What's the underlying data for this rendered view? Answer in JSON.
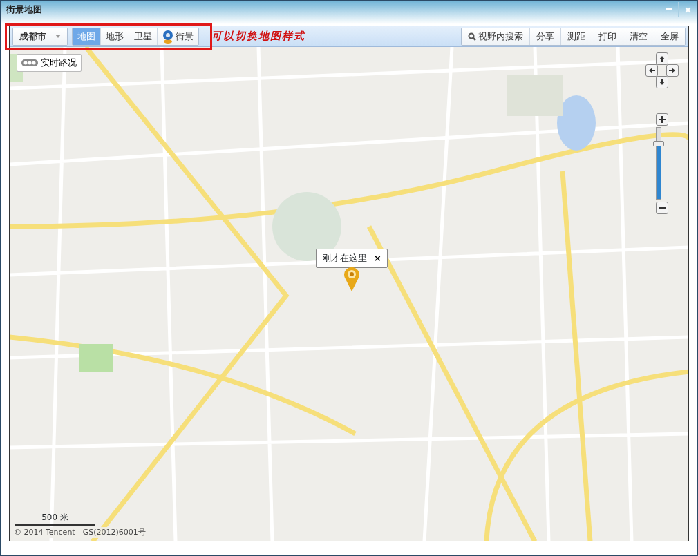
{
  "window": {
    "title": "街景地图"
  },
  "toolbar": {
    "city_select": {
      "value": "成都市"
    },
    "map_types": [
      {
        "label": "地图",
        "selected": true,
        "kind": "plain"
      },
      {
        "label": "地形",
        "selected": false,
        "kind": "plain"
      },
      {
        "label": "卫星",
        "selected": false,
        "kind": "plain"
      },
      {
        "label": "街景",
        "selected": false,
        "kind": "street"
      }
    ],
    "annotation": "可以切换地图样式",
    "tools": [
      {
        "label": "视野内搜索",
        "kind": "search"
      },
      {
        "label": "分享",
        "kind": "plain"
      },
      {
        "label": "测距",
        "kind": "plain"
      },
      {
        "label": "打印",
        "kind": "plain"
      },
      {
        "label": "清空",
        "kind": "plain"
      },
      {
        "label": "全屏",
        "kind": "plain"
      }
    ]
  },
  "map": {
    "traffic_button": "实时路况",
    "marker_popup": {
      "text": "刚才在这里",
      "close": "×"
    },
    "zoom": {
      "level": 0.78
    },
    "scale": "500 米",
    "copyright": "© 2014 Tencent - GS(2012)6001号"
  }
}
